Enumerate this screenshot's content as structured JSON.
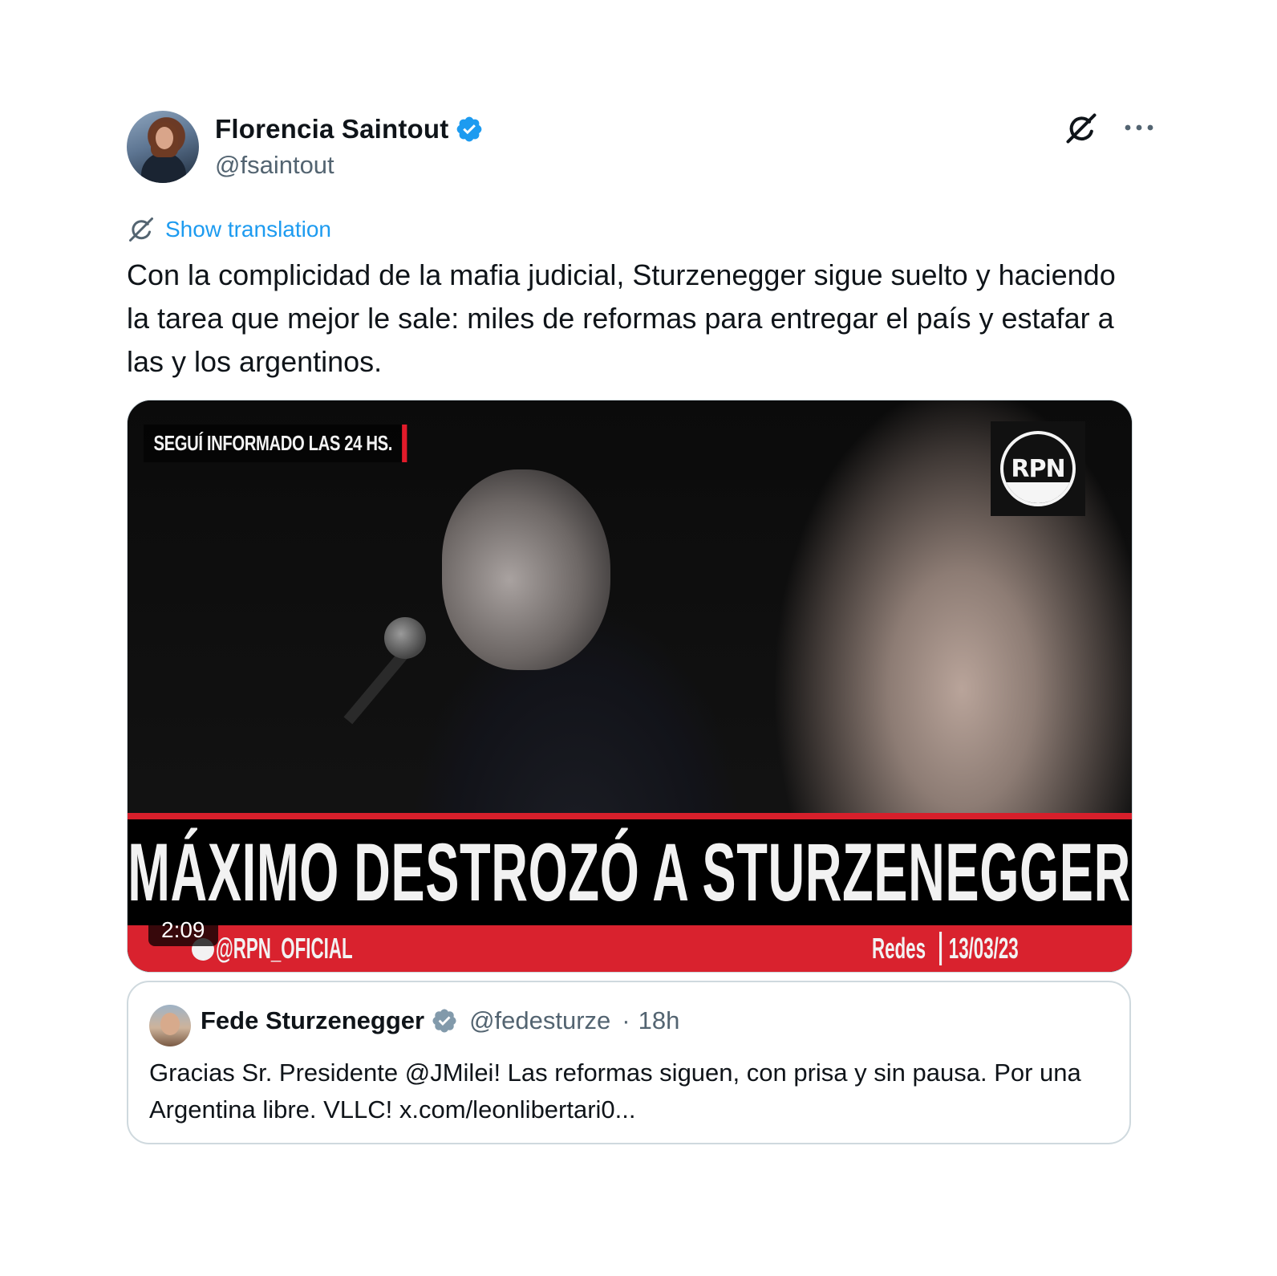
{
  "author": {
    "name": "Florencia Saintout",
    "handle": "@fsaintout"
  },
  "translation": {
    "label": "Show translation"
  },
  "tweet": {
    "text": "Con la complicidad de la mafia judicial, Sturzenegger sigue suelto y haciendo la tarea que mejor le sale: miles de reformas para entregar el país y estafar a las y los argentinos."
  },
  "video": {
    "top_label": "SEGUÍ INFORMADO LAS 24 HS.",
    "logo_text": "RPN",
    "headline": "MÁXIMO DESTROZÓ A STURZENEGGER",
    "channel_handle": "@RPN_OFICIAL",
    "source": "Redes",
    "date": "13/03/23",
    "duration": "2:09"
  },
  "quote": {
    "name": "Fede Sturzenegger",
    "handle": "@fedesturze",
    "separator": "·",
    "time": "18h",
    "text": "Gracias Sr. Presidente @JMilei! Las reformas siguen, con prisa y sin pausa. Por una Argentina libre. VLLC! x.com/leonlibertari0..."
  },
  "colors": {
    "link_blue": "#1d9bf0",
    "verified_blue": "#1d9bf0",
    "secondary_text": "#536471",
    "primary_text": "#0f1419",
    "border": "#cfd9de",
    "news_red": "#d9222e"
  },
  "icons": [
    "verified-badge-icon",
    "grok-icon",
    "more-icon",
    "translate-icon"
  ]
}
